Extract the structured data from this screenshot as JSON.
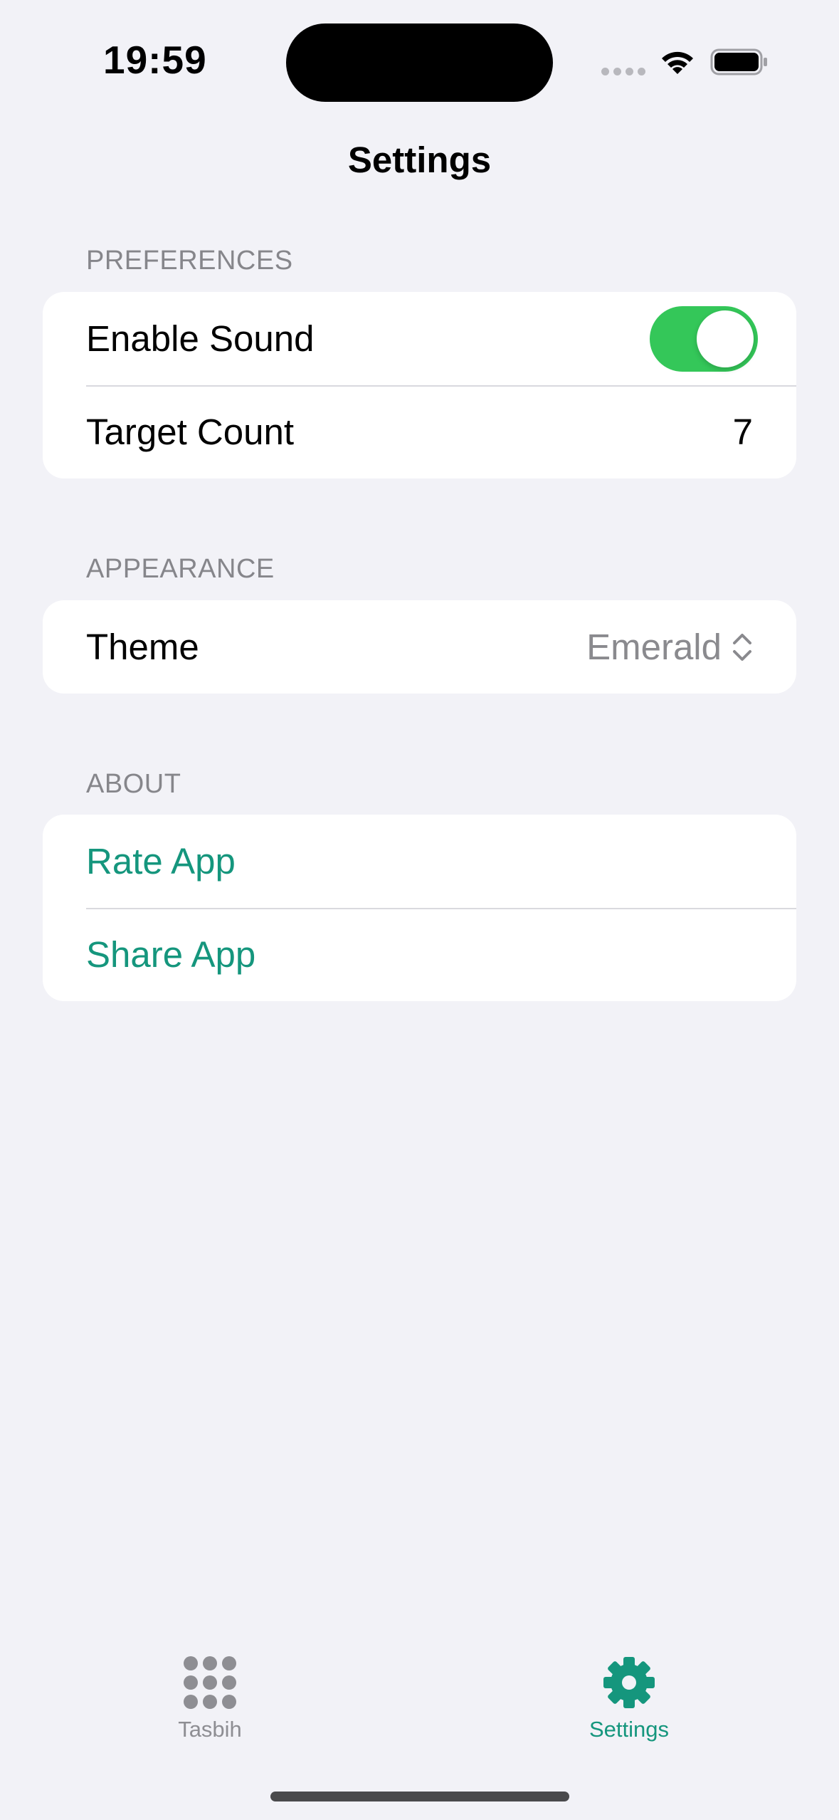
{
  "status_bar": {
    "time": "19:59"
  },
  "nav": {
    "title": "Settings"
  },
  "sections": {
    "preferences": {
      "header": "PREFERENCES",
      "enable_sound": {
        "label": "Enable Sound",
        "value": true
      },
      "target_count": {
        "label": "Target Count",
        "value": "7"
      }
    },
    "appearance": {
      "header": "APPEARANCE",
      "theme": {
        "label": "Theme",
        "value": "Emerald"
      }
    },
    "about": {
      "header": "ABOUT",
      "rate_app": "Rate App",
      "share_app": "Share App"
    }
  },
  "tab_bar": {
    "tabs": [
      {
        "label": "Tasbih",
        "icon": "grid-dots-icon",
        "selected": false
      },
      {
        "label": "Settings",
        "icon": "gear-icon",
        "selected": true
      }
    ]
  },
  "colors": {
    "accent": "#15967d",
    "toggle_on": "#34c759",
    "background": "#f2f2f7",
    "secondary_text": "#86868b",
    "tab_inactive": "#8e8e93"
  }
}
